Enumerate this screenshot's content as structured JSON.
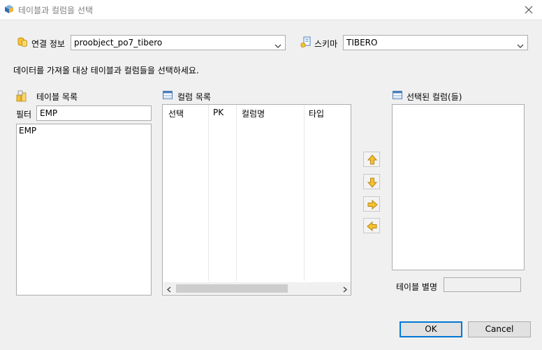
{
  "window": {
    "title": "테이블과 컬럼을 선택"
  },
  "connection": {
    "label": "연결 정보",
    "value": "proobject_po7_tibero"
  },
  "schema": {
    "label": "스키마",
    "value": "TIBERO"
  },
  "instruction": "데이터를 가져올 대상 테이블과 컬럼들을 선택하세요.",
  "table_list": {
    "label": "테이블 목록",
    "filter_label": "필터",
    "filter_value": "EMP",
    "items": [
      "EMP"
    ]
  },
  "column_list": {
    "label": "컬럼 목록",
    "headers": [
      "선택",
      "PK",
      "컬럼명",
      "타입"
    ]
  },
  "selected_columns": {
    "label": "선택된 컬럼(들)"
  },
  "table_alias": {
    "label": "테이블 별명",
    "value": ""
  },
  "buttons": {
    "ok": "OK",
    "cancel": "Cancel"
  },
  "colors": {
    "accent": "#0078d7",
    "icon_yellow": "#f6c12e",
    "icon_blue": "#4a7ebb"
  }
}
